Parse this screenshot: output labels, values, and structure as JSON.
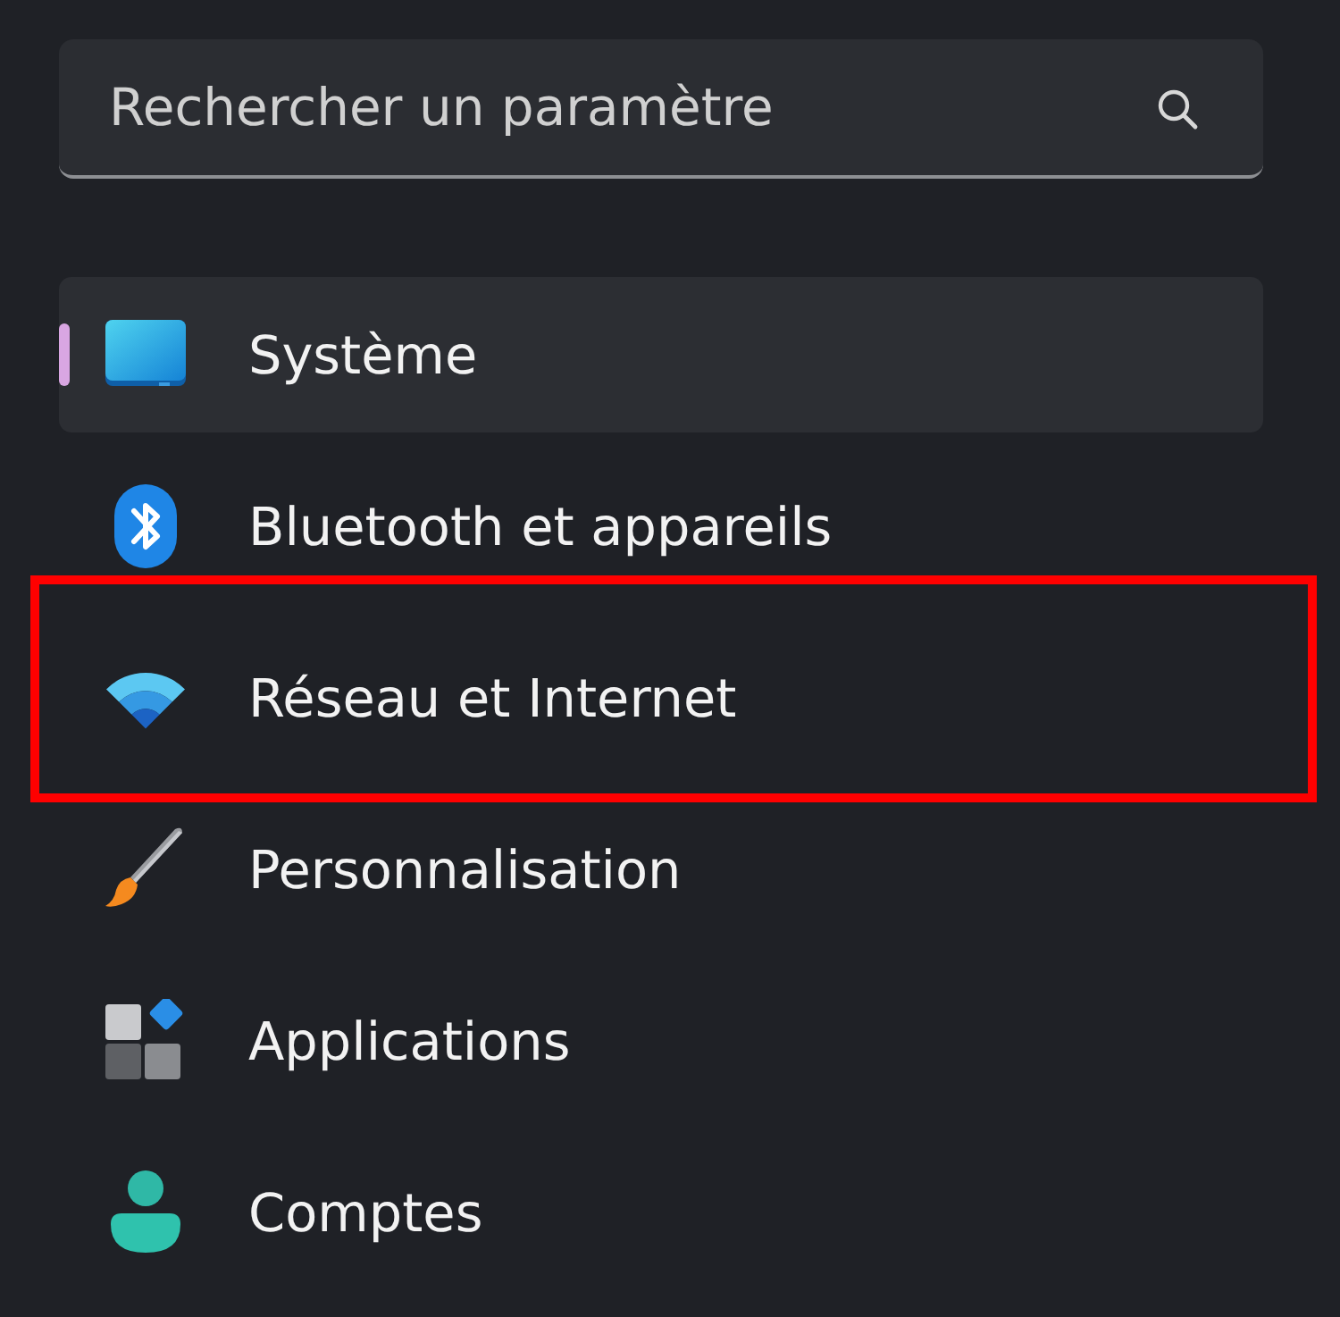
{
  "search": {
    "placeholder": "Rechercher un paramètre"
  },
  "nav": {
    "items": [
      {
        "label": "Système",
        "kind": "system",
        "selected": true,
        "annotated": false
      },
      {
        "label": "Bluetooth et appareils",
        "kind": "bluetooth",
        "selected": false,
        "annotated": false
      },
      {
        "label": "Réseau et Internet",
        "kind": "network",
        "selected": false,
        "annotated": true
      },
      {
        "label": "Personnalisation",
        "kind": "brush",
        "selected": false,
        "annotated": false
      },
      {
        "label": "Applications",
        "kind": "apps",
        "selected": false,
        "annotated": false
      },
      {
        "label": "Comptes",
        "kind": "account",
        "selected": false,
        "annotated": false
      }
    ]
  }
}
